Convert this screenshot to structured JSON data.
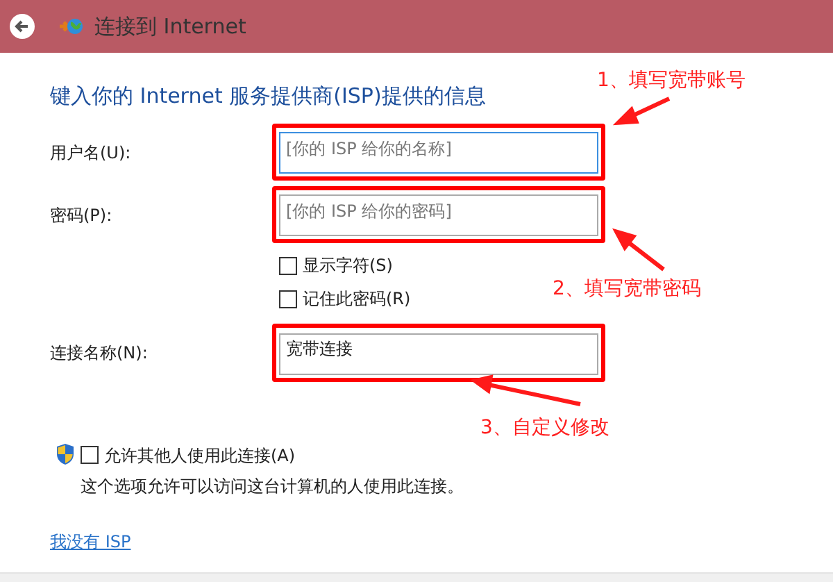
{
  "window": {
    "title": "连接到 Internet"
  },
  "heading": "键入你的 Internet 服务提供商(ISP)提供的信息",
  "fields": [
    {
      "label": "用户名(U):",
      "placeholder": "[你的 ISP 给你的名称]",
      "focused": true,
      "highlighted": true
    },
    {
      "label": "密码(P):",
      "placeholder": "[你的 ISP 给你的密码]",
      "focused": false,
      "highlighted": true
    },
    {
      "label": "连接名称(N):",
      "value": "宽带连接",
      "focused": false,
      "highlighted": true
    }
  ],
  "password_options": [
    {
      "label": "显示字符(S)",
      "checked": false
    },
    {
      "label": "记住此密码(R)",
      "checked": false
    }
  ],
  "allow_others": {
    "label": "允许其他人使用此连接(A)",
    "checked": false,
    "description": "这个选项允许可以访问这台计算机的人使用此连接。"
  },
  "link": "我没有 ISP",
  "annotations": [
    {
      "text": "1、填写宽带账号"
    },
    {
      "text": "2、填写宽带密码"
    },
    {
      "text": "3、自定义修改"
    }
  ]
}
